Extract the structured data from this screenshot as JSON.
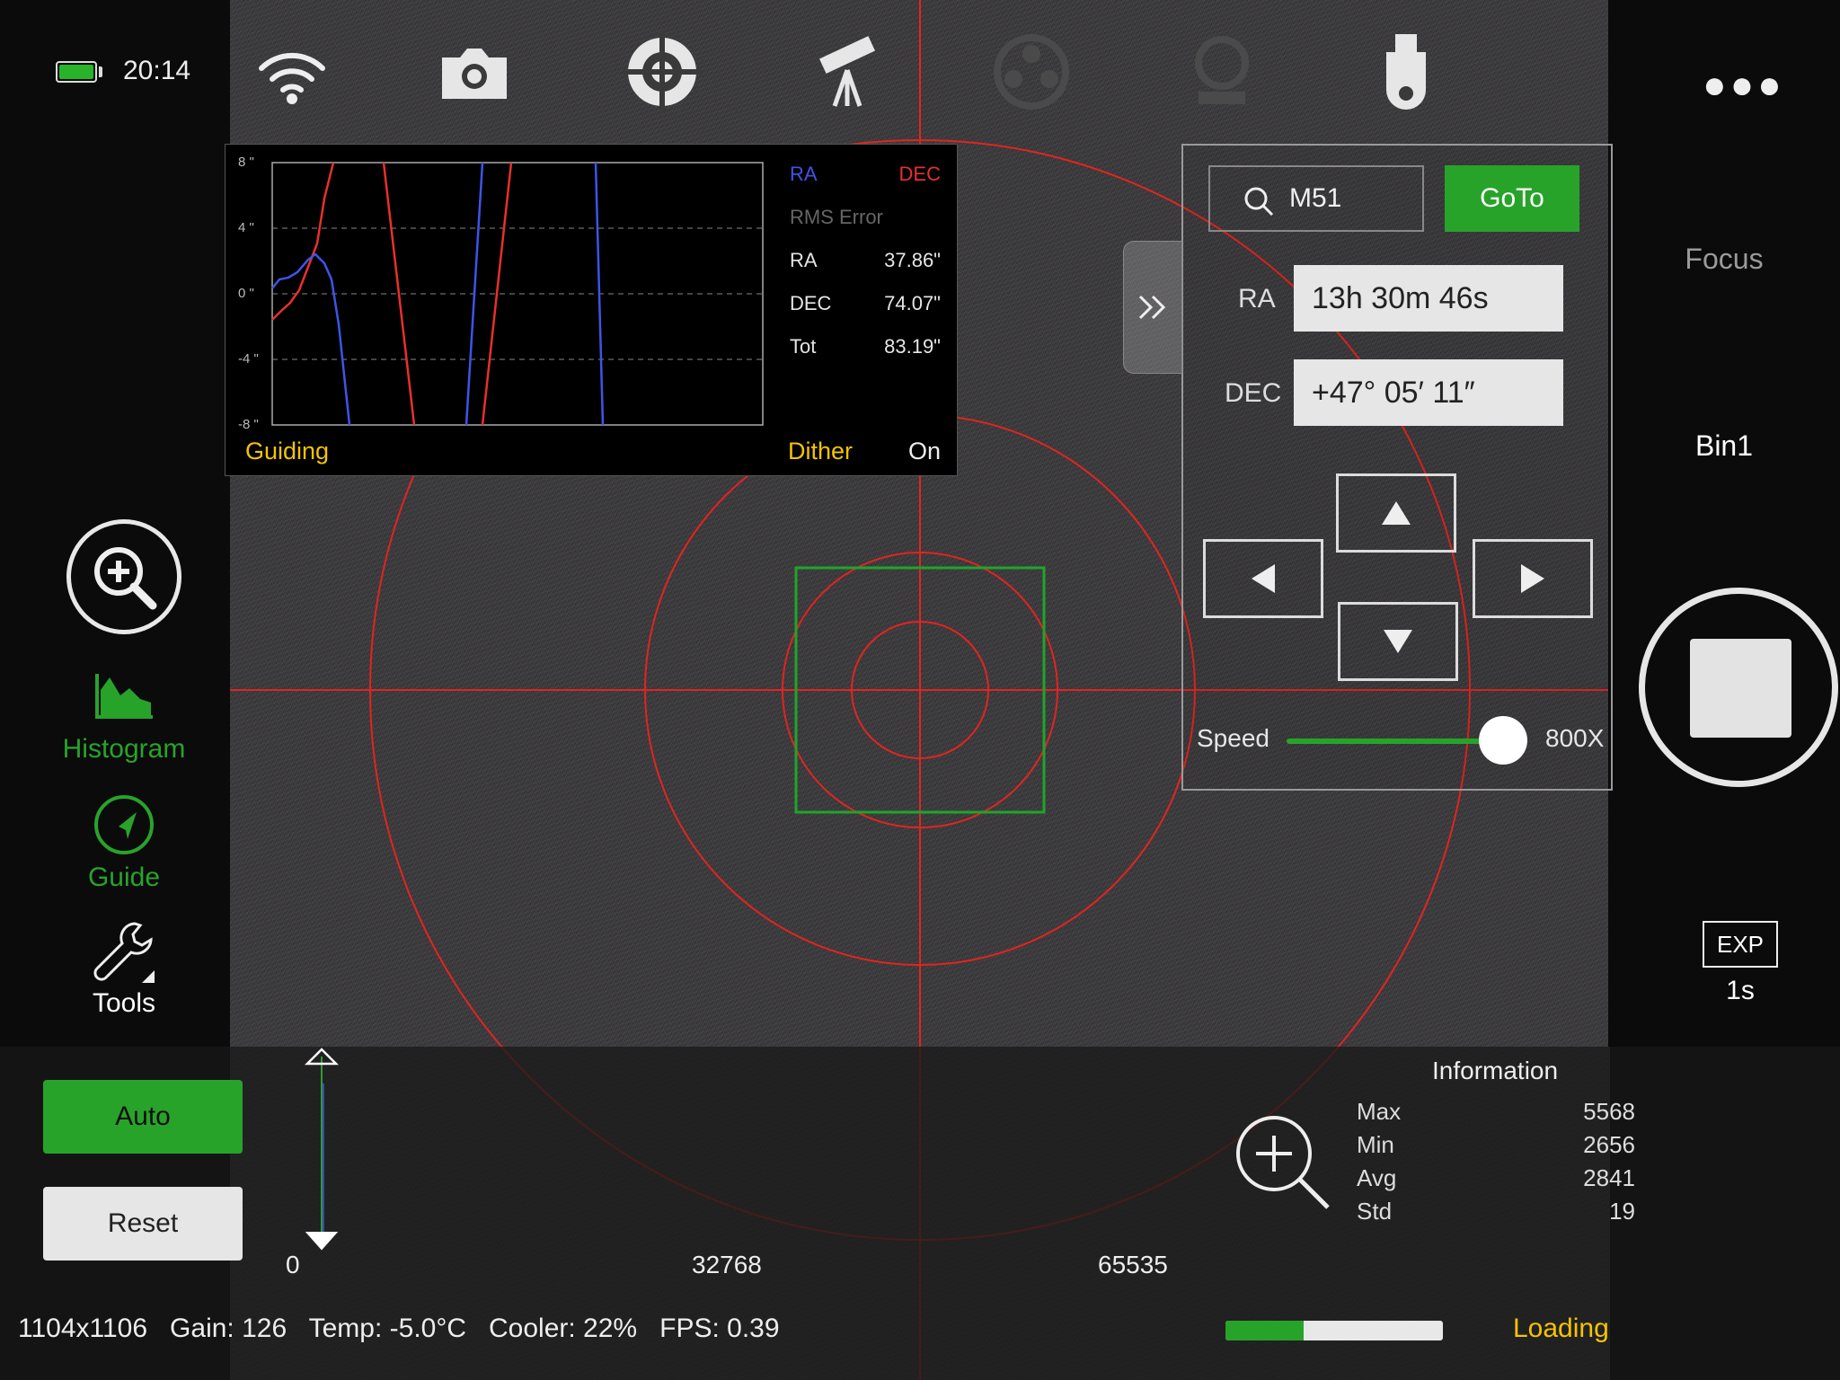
{
  "status": {
    "time": "20:14",
    "battery_color": "#29b32a"
  },
  "toolbar": {
    "icons": [
      "wifi-icon",
      "camera-icon",
      "crosshair-icon",
      "telescope-icon",
      "filter-wheel-icon",
      "focuser-icon",
      "usb-drive-icon"
    ]
  },
  "guiding": {
    "y_ticks": [
      "8 \"",
      "4 \"",
      "0 \"",
      "-4 \"",
      "-8 \""
    ],
    "legend_ra": "RA",
    "legend_dec": "DEC",
    "rms_title": "RMS Error",
    "rows": [
      {
        "label": "RA",
        "value": "37.86\""
      },
      {
        "label": "DEC",
        "value": "74.07\""
      },
      {
        "label": "Tot",
        "value": "83.19\""
      }
    ],
    "status_label": "Guiding",
    "dither_label": "Dither",
    "dither_value": "On",
    "colors": {
      "ra": "#3d55e6",
      "dec": "#e8302c"
    }
  },
  "mount": {
    "search_value": "M51",
    "goto_label": "GoTo",
    "ra_label": "RA",
    "ra_value": "13h 30m 46s",
    "dec_label": "DEC",
    "dec_value": "+47° 05′ 11″",
    "speed_label": "Speed",
    "speed_value": "800X"
  },
  "left_nav": {
    "histogram_label": "Histogram",
    "guide_label": "Guide",
    "tools_label": "Tools",
    "accent": "#28a32a"
  },
  "right_controls": {
    "focus_label": "Focus",
    "bin_label": "Bin1",
    "exp_label": "EXP",
    "exp_value": "1s"
  },
  "histogram": {
    "auto_label": "Auto",
    "reset_label": "Reset",
    "axis": [
      "0",
      "32768",
      "65535"
    ],
    "info_title": "Information",
    "stats": [
      {
        "label": "Max",
        "value": "5568"
      },
      {
        "label": "Min",
        "value": "2656"
      },
      {
        "label": "Avg",
        "value": "2841"
      },
      {
        "label": "Std",
        "value": "19"
      }
    ]
  },
  "statusbar": {
    "resolution": "1104x1106",
    "gain": "Gain: 126",
    "temp": "Temp: -5.0°C",
    "cooler": "Cooler: 22%",
    "fps": "FPS: 0.39",
    "loading_label": "Loading",
    "loading_progress": 0.36
  }
}
